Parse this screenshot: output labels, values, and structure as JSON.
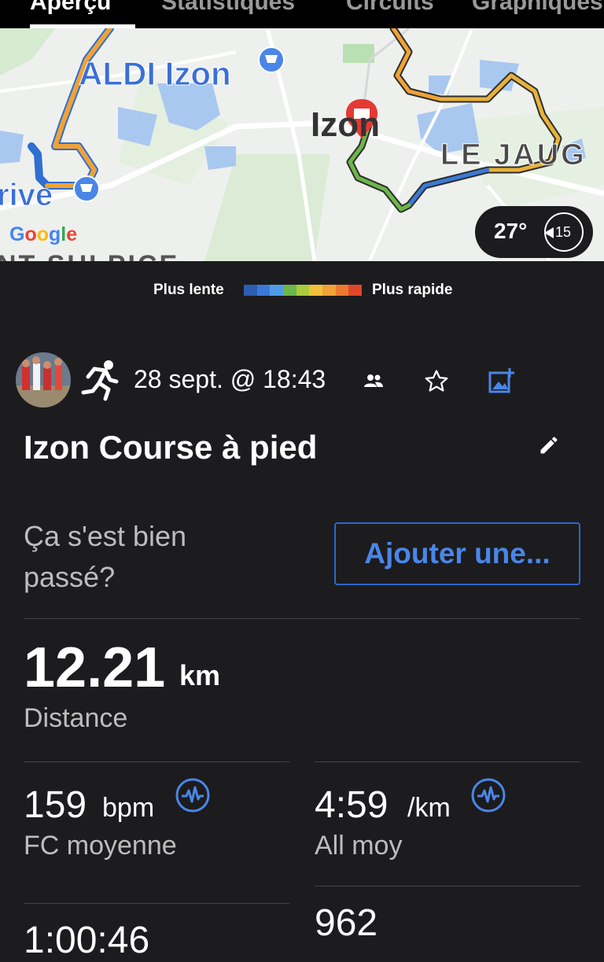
{
  "tabs": [
    {
      "label": "Aperçu"
    },
    {
      "label": "Statistiques"
    },
    {
      "label": "Circuits"
    },
    {
      "label": "Graphiques"
    }
  ],
  "map": {
    "labels": {
      "aldi": "ALDI Izon",
      "izon": "Izon",
      "jaugue": "LE JAUG",
      "drive": "rive",
      "sulpice": "NT-SULPICE"
    },
    "attribution": [
      "G",
      "o",
      "o",
      "g",
      "l",
      "e"
    ],
    "weather": {
      "temperature": "27°",
      "wind_speed": "15"
    }
  },
  "pace_legend": {
    "slow_label": "Plus lente",
    "fast_label": "Plus rapide",
    "colors": [
      "#2c5fb0",
      "#3a7ad6",
      "#4f9be8",
      "#6db64a",
      "#a8cc3c",
      "#f0c23a",
      "#f0a236",
      "#ec7b2f",
      "#e0462a"
    ]
  },
  "activity": {
    "date": "28 sept. @ 18:43",
    "title": "Izon Course à pied",
    "feedback_prompt": "Ça s'est bien passé?",
    "add_button": "Ajouter une..."
  },
  "stats": {
    "distance": {
      "value": "12.21",
      "unit": "km",
      "label": "Distance"
    },
    "heart_rate": {
      "value": "159",
      "unit": "bpm",
      "label": "FC moyenne"
    },
    "pace": {
      "value": "4:59",
      "unit": "/km",
      "label": "All moy"
    },
    "time": {
      "value": "1:00:46"
    },
    "calories": {
      "value": "962"
    }
  },
  "colors": {
    "accent": "#4a86e8",
    "background": "#1c1c1e",
    "pin": "#e53935"
  }
}
